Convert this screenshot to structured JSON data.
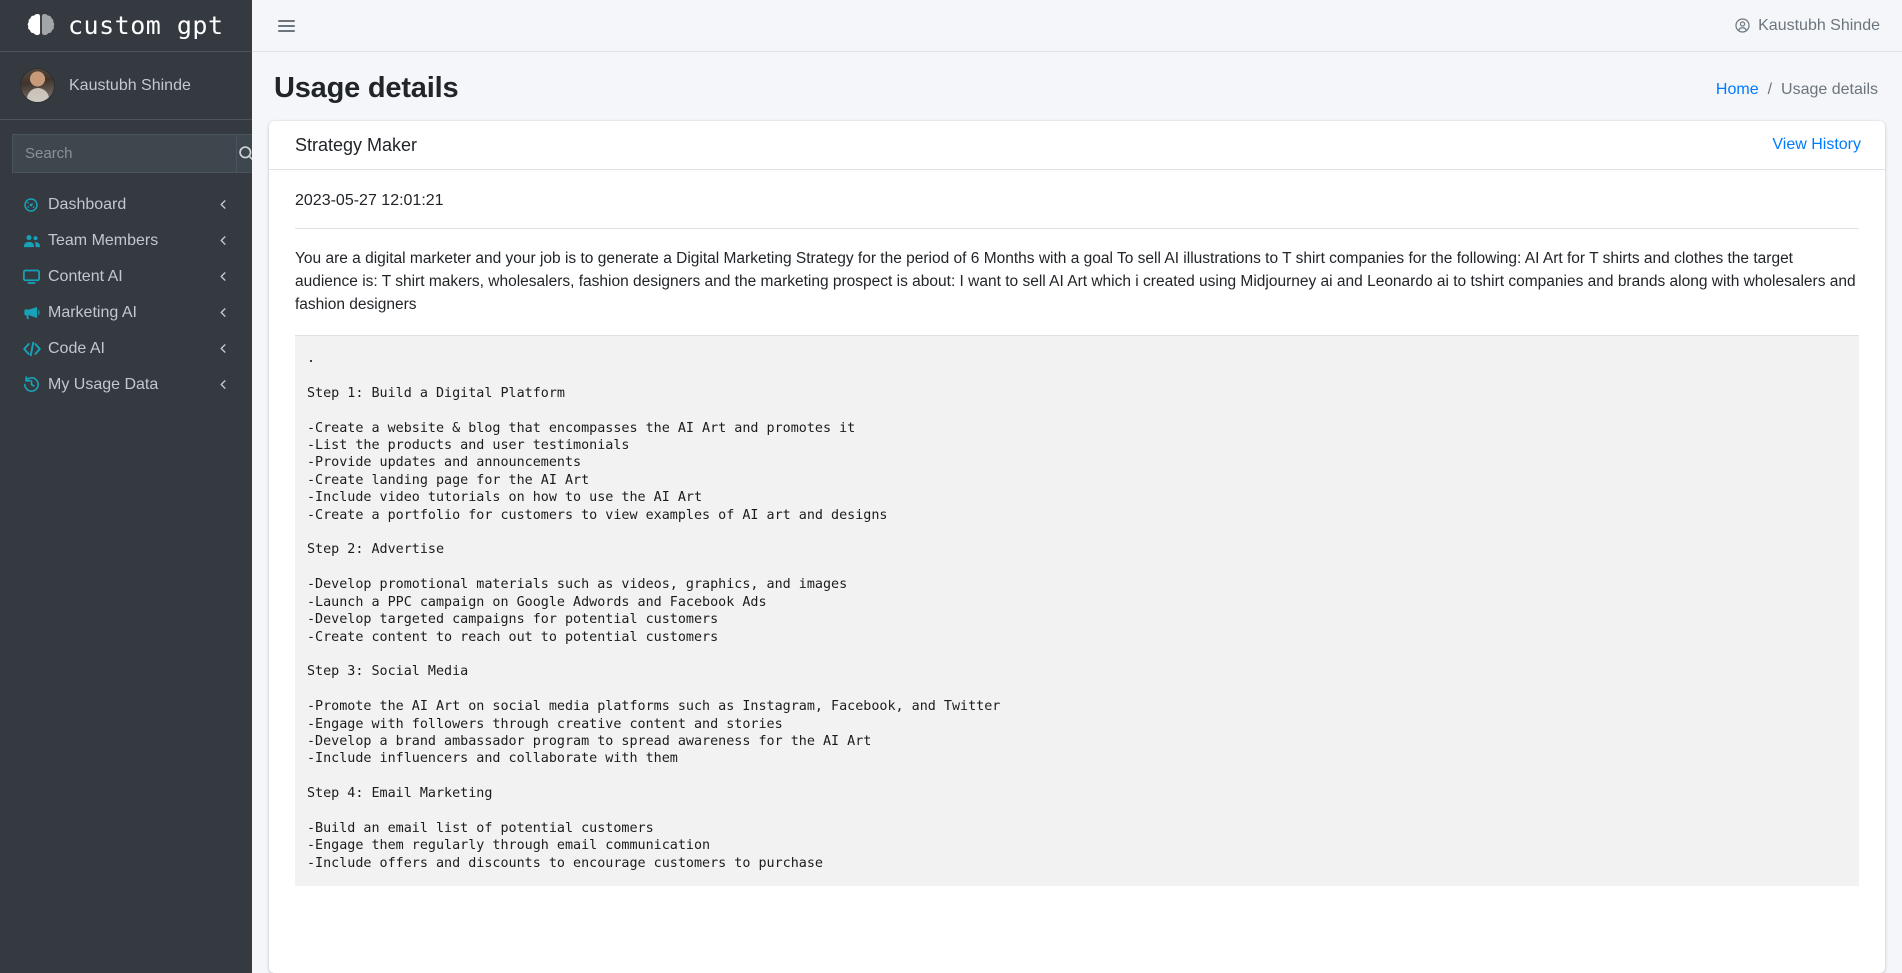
{
  "sidebar": {
    "brand": {
      "text": "custom gpt",
      "icon": "brain-icon"
    },
    "user": {
      "name": "Kaustubh Shinde"
    },
    "search": {
      "placeholder": "Search",
      "value": "",
      "button_icon": "search-icon"
    },
    "items": [
      {
        "label": "Dashboard",
        "icon": "tachometer-icon",
        "chevron": "chevron-left-icon"
      },
      {
        "label": "Team Members",
        "icon": "users-icon",
        "chevron": "chevron-left-icon"
      },
      {
        "label": "Content AI",
        "icon": "desktop-icon",
        "chevron": "chevron-left-icon"
      },
      {
        "label": "Marketing AI",
        "icon": "bullhorn-icon",
        "chevron": "chevron-left-icon"
      },
      {
        "label": "Code AI",
        "icon": "code-icon",
        "chevron": "chevron-left-icon"
      },
      {
        "label": "My Usage Data",
        "icon": "clock-rotate-icon",
        "chevron": "chevron-left-icon"
      }
    ]
  },
  "topbar": {
    "menu_icon": "hamburger-icon",
    "user_icon": "user-circle-icon",
    "user_name": "Kaustubh Shinde"
  },
  "page": {
    "title": "Usage details",
    "breadcrumb": {
      "home": "Home",
      "separator": "/",
      "current": "Usage details"
    }
  },
  "card": {
    "title": "Strategy Maker",
    "view_history": "View History",
    "timestamp": "2023-05-27 12:01:21",
    "prompt": "You are a digital marketer and your job is to generate a Digital Marketing Strategy for the period of 6 Months with a goal To sell AI illustrations to T shirt companies for the following: AI Art for T shirts and clothes the target audience is: T shirt makers, wholesalers, fashion designers and the marketing prospect is about: I want to sell AI Art which i created using Midjourney ai and Leonardo ai to tshirt companies and brands along with wholesalers and fashion designers",
    "output": ".\n\nStep 1: Build a Digital Platform\n\n-Create a website & blog that encompasses the AI Art and promotes it\n-List the products and user testimonials\n-Provide updates and announcements\n-Create landing page for the AI Art\n-Include video tutorials on how to use the AI Art\n-Create a portfolio for customers to view examples of AI art and designs\n\nStep 2: Advertise\n\n-Develop promotional materials such as videos, graphics, and images\n-Launch a PPC campaign on Google Adwords and Facebook Ads\n-Develop targeted campaigns for potential customers\n-Create content to reach out to potential customers\n\nStep 3: Social Media\n\n-Promote the AI Art on social media platforms such as Instagram, Facebook, and Twitter\n-Engage with followers through creative content and stories\n-Develop a brand ambassador program to spread awareness for the AI Art\n-Include influencers and collaborate with them\n\nStep 4: Email Marketing\n\n-Build an email list of potential customers\n-Engage them regularly through email communication\n-Include offers and discounts to encourage customers to purchase"
  },
  "colors": {
    "sidebar_bg": "#343a40",
    "accent_cyan": "#17a2b8",
    "link_blue": "#007bff",
    "content_bg": "#f4f6f9",
    "output_bg": "#f2f2f2"
  }
}
